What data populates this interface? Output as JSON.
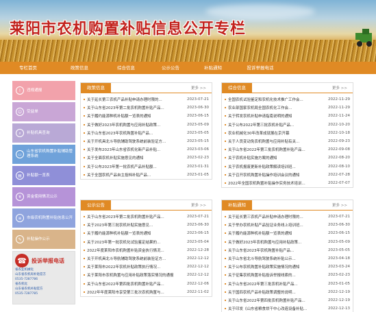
{
  "banner": {
    "title": "莱阳市农机购置补贴信息公开专栏"
  },
  "nav": [
    "专栏首页",
    "政策信息",
    "综合信息",
    "公示公告",
    "补贴通知",
    "投诉举报电话"
  ],
  "sidebar": {
    "items": [
      {
        "label": "违规通报",
        "color": "#f2a2ab"
      },
      {
        "label": "受益单",
        "color": "#c9a6d6"
      },
      {
        "label": "补贴机具查询",
        "color": "#b9a9d6"
      },
      {
        "label": "山东省农机购置补贴辅助管理系统",
        "color": "#6fa2da"
      },
      {
        "label": "补贴额一览表",
        "color": "#8f8fd8"
      },
      {
        "label": "资金使用情况公示",
        "color": "#b693d8"
      },
      {
        "label": "市级农机购置补贴信息公开",
        "color": "#8fa4de"
      },
      {
        "label": "补贴操作公示",
        "color": "#d9b48a"
      }
    ],
    "report": {
      "title": "投诉举报电话",
      "lines": [
        "省农业机械化",
        "山东省农机局补贴官方",
        "0535-7287786",
        "省农机化",
        "山东省农机补贴官方",
        "0535-7287785"
      ]
    }
  },
  "panels": {
    "policy": {
      "title": "政策信息",
      "more": "更多 >>",
      "rows": [
        {
          "t": "关于延长第三农机产品补贴申请办理时限的...",
          "d": "2023-07-21"
        },
        {
          "t": "关于山东省2023年第二批农机购置补贴产品...",
          "d": "2023-06-30"
        },
        {
          "t": "关于履约能源种机补贴额一览表的通知",
          "d": "2023-06-15"
        },
        {
          "t": "关于做好2023年农机购置与应用补贴政策...",
          "d": "2023-05-09"
        },
        {
          "t": "关于山东省2023年农机购置补贴产品...",
          "d": "2023-05-05"
        },
        {
          "t": "关于开机具北斗导航辅助驾驶系统前装验证方...",
          "d": "2023-05-15"
        },
        {
          "t": "关于发布2023年山东省农机化新产品补贴...",
          "d": "2023-03-06"
        },
        {
          "t": "关于全面农机补贴实施意见的通知",
          "d": "2023-02-23"
        },
        {
          "t": "关于公布2023年第一批农机产品补贴额...",
          "d": "2023-01-31"
        },
        {
          "t": "关于全国农机产品自主投档补贴产品...",
          "d": "2023-01-05"
        }
      ]
    },
    "general": {
      "title": "综合信息",
      "more": "更多 >>",
      "rows": [
        {
          "t": "全国农机试验鉴定和农机化技术推广工作会...",
          "d": "2022-11-29"
        },
        {
          "t": "农业部国家农机局全国农机化工作会...",
          "d": "2022-11-29"
        },
        {
          "t": "关于转发农机补贴申请指南说明的通知",
          "d": "2022-11-24"
        },
        {
          "t": "关于公布2022年第三批农机补贴产品...",
          "d": "2022-10-20"
        },
        {
          "t": "农业机械化30年改革成就展在京开幕",
          "d": "2022-10-18"
        },
        {
          "t": "关于人员变动免农机购置与应用补贴有关...",
          "d": "2022-09-23"
        },
        {
          "t": "关于山东省2022年第三批农机购置补贴产品...",
          "d": "2022-09-08"
        },
        {
          "t": "关于农机补贴实施方案的通知",
          "d": "2022-08-20"
        },
        {
          "t": "关于农机报废更新补贴政策解读培训班...",
          "d": "2022-08-10"
        },
        {
          "t": "关于召开农机购置补贴操作培训会议的通知",
          "d": "2022-07-28"
        },
        {
          "t": "2022年全国农机购置补贴操作实务技术培训...",
          "d": "2022-07-07"
        }
      ]
    },
    "notice": {
      "title": "公示公告",
      "more": "更多 >>",
      "rows": [
        {
          "t": "关于山东省2023年第二批农机购置补贴产品...",
          "d": "2023-07-21"
        },
        {
          "t": "关于2023年第三批农机补贴实施意见...",
          "d": "2023-06-30"
        },
        {
          "t": "关于履约能源种机补贴额一览表的通知",
          "d": "2023-06-15"
        },
        {
          "t": "关于2023年第一批农机化试验鉴定结果的...",
          "d": "2023-05-04"
        },
        {
          "t": "2022年度莱阳市农机购置补贴资金执行情况...",
          "d": "2022-12-28"
        },
        {
          "t": "关于开机具北斗导航辅助驾驶系统前装验证方...",
          "d": "2022-12-12"
        },
        {
          "t": "关于莱阳市2022年农机补贴政策执行情况...",
          "d": "2022-12-12"
        },
        {
          "t": "关于莱阳市农机购置与应用补贴政策落实情况的通报",
          "d": "2022-12-12"
        },
        {
          "t": "关于山东省2022年第四批农机购置补贴产品...",
          "d": "2022-12-06"
        },
        {
          "t": "2022年年度莱阳市享受第三批次农机购置与...",
          "d": "2022-11-02"
        }
      ]
    },
    "subsidy": {
      "title": "补贴通知",
      "more": "更多 >>",
      "rows": [
        {
          "t": "关于延长第三农机产品补贴申请办理时限的...",
          "d": "2023-07-21"
        },
        {
          "t": "关于举办农机补贴产品验证业务线上培训班...",
          "d": "2023-06-30"
        },
        {
          "t": "关于履约能源种机补贴额一览表的通知",
          "d": "2023-06-15"
        },
        {
          "t": "关于做好2023年农机购置与应用补贴政策...",
          "d": "2023-05-09"
        },
        {
          "t": "关于山东省2023年农机购置补贴产品...",
          "d": "2023-05-05"
        },
        {
          "t": "关于山东省北斗导航驾驶系统补贴公示...",
          "d": "2023-04-18"
        },
        {
          "t": "关于公布农机购置补贴政策实施情况的通知",
          "d": "2023-03-24"
        },
        {
          "t": "关于征集农机购置补贴投诉举报线索的...",
          "d": "2023-02-23"
        },
        {
          "t": "关于山东省2022年第三批农机补贴产品...",
          "d": "2023-01-05"
        },
        {
          "t": "关于国四农机产品补贴政策调整的说明...",
          "d": "2022-12-19"
        },
        {
          "t": "关于山东省2022年第四批农机购置补贴产品...",
          "d": "2022-12-19"
        },
        {
          "t": "关于印发《山东省粮食烘干中心改造设备补贴...",
          "d": "2022-12-13"
        }
      ]
    }
  }
}
